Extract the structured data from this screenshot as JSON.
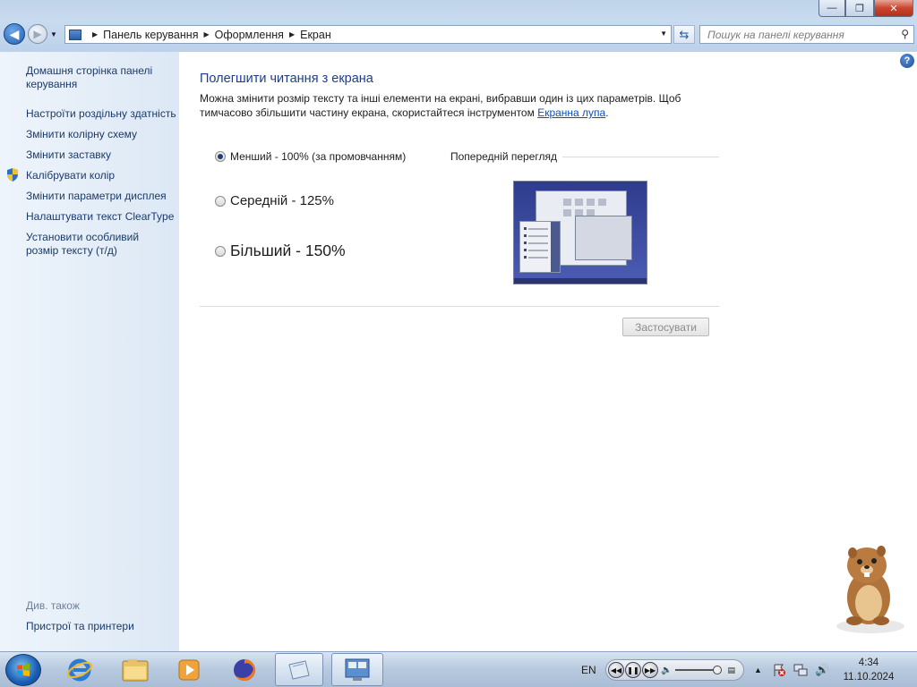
{
  "window": {
    "controls": {
      "minimize": "—",
      "restore": "❐",
      "close": "✕"
    }
  },
  "nav": {
    "back": "◀",
    "forward": "▶",
    "breadcrumb": [
      "Панель керування",
      "Оформлення",
      "Екран"
    ],
    "search_placeholder": "Пошук на панелі керування"
  },
  "sidebar": {
    "home": "Домашня сторінка панелі керування",
    "links": [
      "Настроїти роздільну здатність",
      "Змінити колірну схему",
      "Змінити заставку",
      "Калібрувати колір",
      "Змінити параметри дисплея",
      "Налаштувати текст ClearType",
      "Установити особливий розмір тексту (т/д)"
    ],
    "see_also_label": "Див. також",
    "see_also_links": [
      "Пристрої та принтери"
    ]
  },
  "main": {
    "title": "Полегшити читання з екрана",
    "description_before": "Можна змінити розмір тексту та інші елементи на екрані, вибравши один із цих параметрів. Щоб тимчасово збільшити частину екрана, скористайтеся інструментом ",
    "description_link": "Екранна лупа",
    "description_after": ".",
    "options": [
      {
        "label": "Менший - 100% (за промовчанням)",
        "selected": true
      },
      {
        "label": "Середній - 125%",
        "selected": false
      },
      {
        "label": "Більший - 150%",
        "selected": false
      }
    ],
    "preview_label": "Попередній перегляд",
    "apply_button": "Застосувати",
    "apply_enabled": false
  },
  "taskbar": {
    "apps": [
      "ie-icon",
      "explorer-icon",
      "media-player-icon",
      "firefox-icon",
      "files-icon",
      "control-panel-icon"
    ],
    "active_app": "control-panel-icon",
    "language": "EN",
    "clock_time": "4:34",
    "clock_date": "11.10.2024"
  },
  "colors": {
    "title_blue": "#1c3e8a",
    "link_blue": "#0b4fb8",
    "sidebar_link": "#1b3a6a"
  }
}
